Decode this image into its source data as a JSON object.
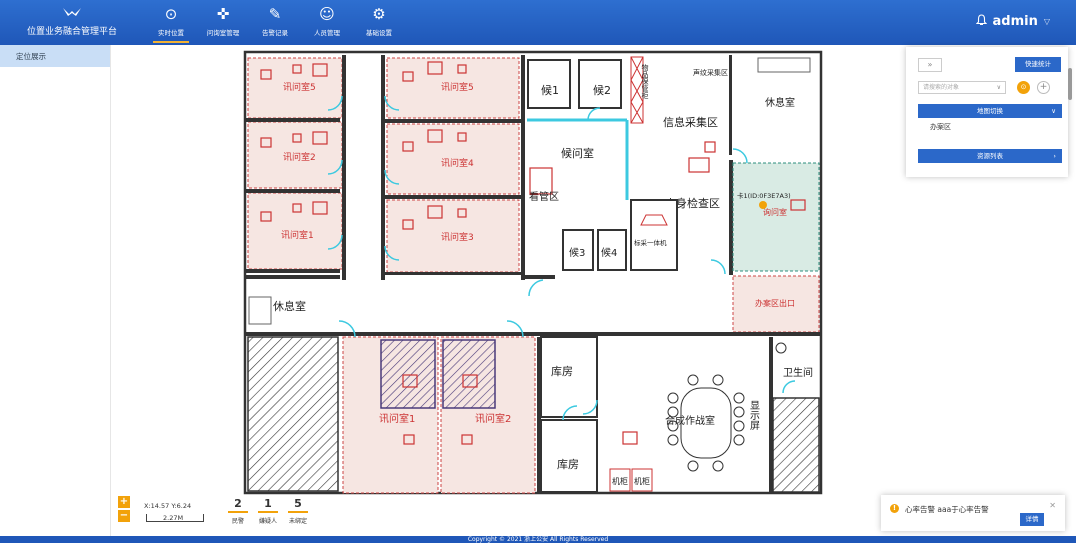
{
  "app": {
    "title": "位置业务融合管理平台",
    "logo_icon": "eagle-logo-icon"
  },
  "nav": [
    {
      "label": "实时位置",
      "icon": "location-pin-icon",
      "glyph": "⊙",
      "active": true
    },
    {
      "label": "问询室管理",
      "icon": "crosshair-icon",
      "glyph": "✜",
      "active": false
    },
    {
      "label": "告警记录",
      "icon": "edit-record-icon",
      "glyph": "✎",
      "active": false
    },
    {
      "label": "人员管理",
      "icon": "person-icon",
      "glyph": "☺",
      "active": false
    },
    {
      "label": "基础设置",
      "icon": "gear-icon",
      "glyph": "⚙",
      "active": false
    }
  ],
  "user": {
    "name": "admin",
    "bell_icon": "bell-icon",
    "chevron_icon": "chevron-down-icon"
  },
  "sidebar": {
    "items": [
      {
        "label": "定位展示",
        "active": true
      }
    ]
  },
  "map": {
    "rooms": {
      "interrogation_5": "讯问室5",
      "interrogation_4": "讯问室4",
      "interrogation_3": "讯问室3",
      "interrogation_5b": "讯问室5",
      "interrogation_2a": "讯问室2",
      "interrogation_1a": "讯问室1",
      "wait_1": "候1",
      "wait_2": "候2",
      "wait_3": "候3",
      "wait_4": "候4",
      "waiting_room": "候问室",
      "viewing_area": "看管区",
      "item_storage": "物品保管柜",
      "info_collection": "信息采集区",
      "voiceprint": "声纹采集区",
      "body_check": "人身检查区",
      "standard_machine": "标采一体机",
      "rest_room_top": "休息室",
      "rest_room_left": "休息室",
      "inquiry_room": "询问室",
      "office_exit": "办案区出口",
      "interrogation_1": "讯问室1",
      "interrogation_2": "讯问室2",
      "storage_1": "库房",
      "storage_2": "库房",
      "command_room": "合成作战室",
      "display_screen": "显示屏",
      "cabinet_1": "机柜",
      "cabinet_2": "机柜",
      "restroom": "卫生间",
      "tag_label": "卡1(ID:0F3E7A3)"
    }
  },
  "scale": {
    "coord": "X:14.57 Y:6.24",
    "distance": "2.27M",
    "zoom_in": "+",
    "zoom_out": "−"
  },
  "stats": [
    {
      "value": "2",
      "label": "民警"
    },
    {
      "value": "1",
      "label": "嫌疑人"
    },
    {
      "value": "5",
      "label": "未绑定"
    }
  ],
  "panel": {
    "collapse": "»",
    "quick_stats": "快速统计",
    "search_placeholder": "请搜索的对象",
    "locate_glyph": "⊙",
    "add_glyph": "+",
    "map_switch": "地图切换",
    "map_item": "办案区",
    "resource_list": "资源列表"
  },
  "alert": {
    "icon": "!",
    "message": "心率告警 aaa于心率告警",
    "close": "✕",
    "detail": "详情"
  },
  "footer": {
    "copyright": "Copyright © 2021 浙上公安 All Rights Reserved"
  }
}
